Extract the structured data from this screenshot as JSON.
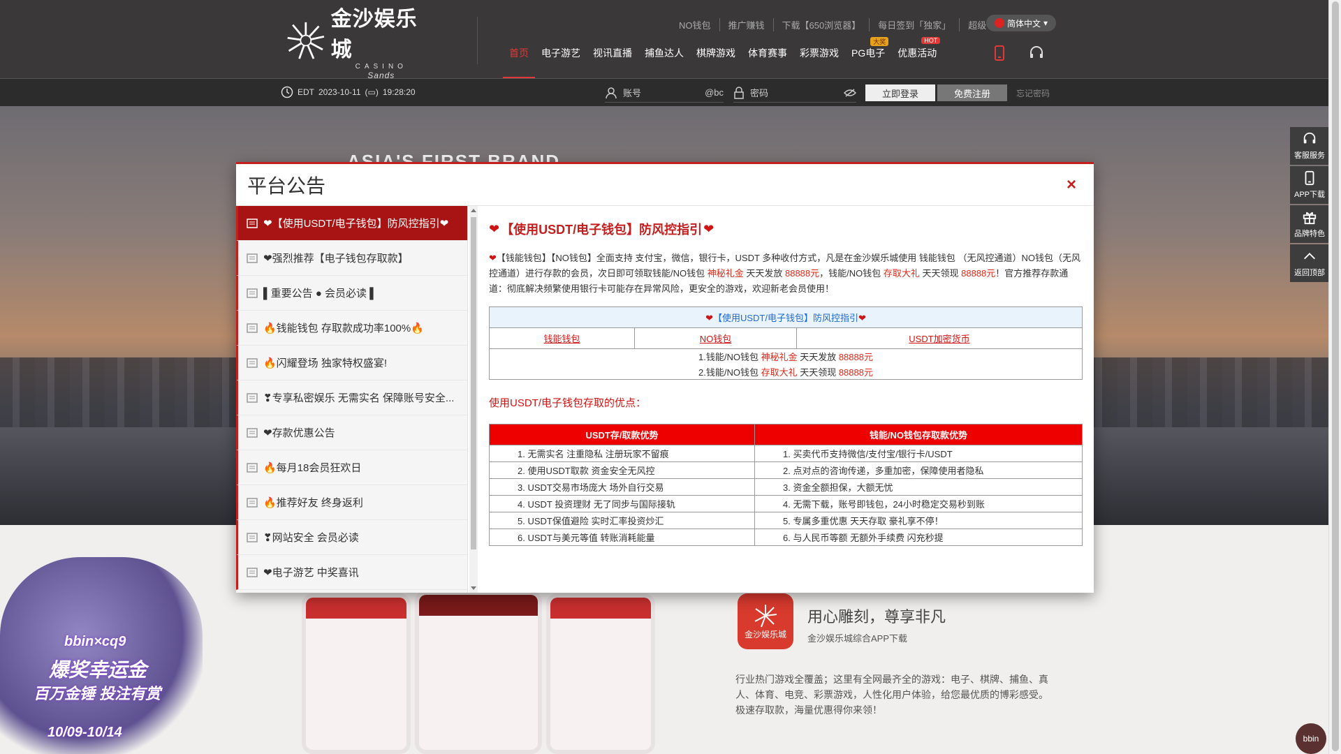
{
  "header": {
    "logo_cn": "金沙娱乐城",
    "logo_casino": "CASINO",
    "logo_sands": "Sands",
    "util_links": [
      "NO钱包",
      "推广赚钱",
      "下载【650浏览器】",
      "每日签到「独家」",
      "超级VIP"
    ],
    "lang": "简体中文",
    "nav": [
      {
        "label": "首页",
        "active": true
      },
      {
        "label": "电子游艺"
      },
      {
        "label": "视讯直播"
      },
      {
        "label": "捕鱼达人"
      },
      {
        "label": "棋牌游戏"
      },
      {
        "label": "体育赛事"
      },
      {
        "label": "彩票游戏"
      },
      {
        "label": "PG电子",
        "badge": "大奖"
      },
      {
        "label": "优惠活动",
        "badge": "HOT"
      }
    ]
  },
  "subbar": {
    "timezone": "EDT",
    "date": "2023-10-11",
    "time": "19:28:20",
    "account_placeholder": "账号",
    "account_suffix": "@bc",
    "password_placeholder": "密码",
    "login_label": "立即登录",
    "register_label": "免费注册",
    "forgot_label": "忘记密码"
  },
  "banner": {
    "tagline": "ASIA'S FIRST BRAND"
  },
  "float_bar": [
    {
      "label": "客服服务",
      "icon": "headset-icon"
    },
    {
      "label": "APP下载",
      "icon": "phone-icon"
    },
    {
      "label": "品牌特色",
      "icon": "gift-icon"
    },
    {
      "label": "返回顶部",
      "icon": "chevron-up-icon"
    }
  ],
  "app_section": {
    "icon_text": "金沙娱乐城",
    "title": "用心雕刻，尊享非凡",
    "subtitle": "金沙娱乐城综合APP下载",
    "description": "行业热门游戏全覆盖；这里有全网最齐全的游戏：电子、棋牌、捕鱼、真人、体育、电竞、彩票游戏，人性化用户体验，给您最优质的博彩感受。极速存取款，海量优惠得你来领！"
  },
  "promo": {
    "brand": "bbin×cq9",
    "line1": "爆奖幸运金",
    "line2": "百万金锤 投注有赏",
    "date": "10/09-10/14"
  },
  "bbin_label": "bbin",
  "modal": {
    "title": "平台公告",
    "close_label": "×",
    "list": [
      "❤【使用USDT/电子钱包】防风控指引❤",
      "❤强烈推荐【电子钱包存取款】",
      "▌重要公告 ● 会员必读 ▌",
      "🔥钱能钱包 存取款成功率100%🔥",
      "🔥闪耀登场 独家特权盛宴!",
      "❣专享私密娱乐 无需实名 保障账号安全...",
      "❤存款优惠公告",
      "🔥每月18会员狂欢日",
      "🔥推荐好友 终身返利",
      "❣网站安全 会员必读",
      "❤电子游艺 中奖喜讯"
    ],
    "content": {
      "title": "【使用USDT/电子钱包】防风控指引",
      "para": {
        "p1": "【钱能钱包】【NO钱包】全面支持 支付宝，微信，银行卡，USDT 多种收付方式，凡是在金沙娱乐城使用 钱能钱包 （无风控通道）NO钱包（无风控通道）进行存款的会员，次日即可领取钱能/NO钱包 ",
        "r1": "神秘礼金",
        "p2": " 天天发放 ",
        "r2": "88888元",
        "p3": "，钱能/NO钱包 ",
        "r3": "存取大礼",
        "p4": " 天天领现 ",
        "r4": "88888元",
        "p5": "！官方推荐存款通道：彻底解决频繁使用银行卡可能存在异常风险，更安全的游戏，欢迎新老会员使用！"
      },
      "table1": {
        "header": "【使用USDT/电子钱包】防风控指引",
        "links": [
          "钱能钱包",
          "NO钱包",
          "USDT加密货币"
        ],
        "row1": {
          "a": "1.钱能/NO钱包 ",
          "r": "神秘礼金",
          "b": " 天天发放 ",
          "v": "88888元"
        },
        "row2": {
          "a": "2.钱能/NO钱包 ",
          "r": "存取大礼",
          "b": " 天天领现 ",
          "v": "88888元"
        }
      },
      "advantages_title": "使用USDT/电子钱包存取的优点：",
      "table2": {
        "col1": "USDT存/取款优势",
        "col2": "钱能/NO钱包存取款优势",
        "rows": [
          [
            "1. 无需实名 注重隐私 注册玩家不留痕",
            "1. 买卖代币支持微信/支付宝/银行卡/USDT"
          ],
          [
            "2. 使用USDT取款 资金安全无风控",
            "2. 点对点的咨询传递，多重加密，保障使用者隐私"
          ],
          [
            "3. USDT交易市场庞大 场外自行交易",
            "3. 资金全额担保，大额无忧"
          ],
          [
            "4. USDT 投资理财 无了同步与国际接轨",
            "4. 无需下载，账号即钱包，24小时稳定交易秒到账"
          ],
          [
            "5. USDT保值避险 实时汇率投资炒汇",
            "5. 专属多重优惠 天天存取 豪礼享不停！"
          ],
          [
            "6. USDT与美元等值 转账消耗能量",
            "6. 与人民币等额 无额外手续费 闪充秒提"
          ]
        ]
      }
    }
  }
}
